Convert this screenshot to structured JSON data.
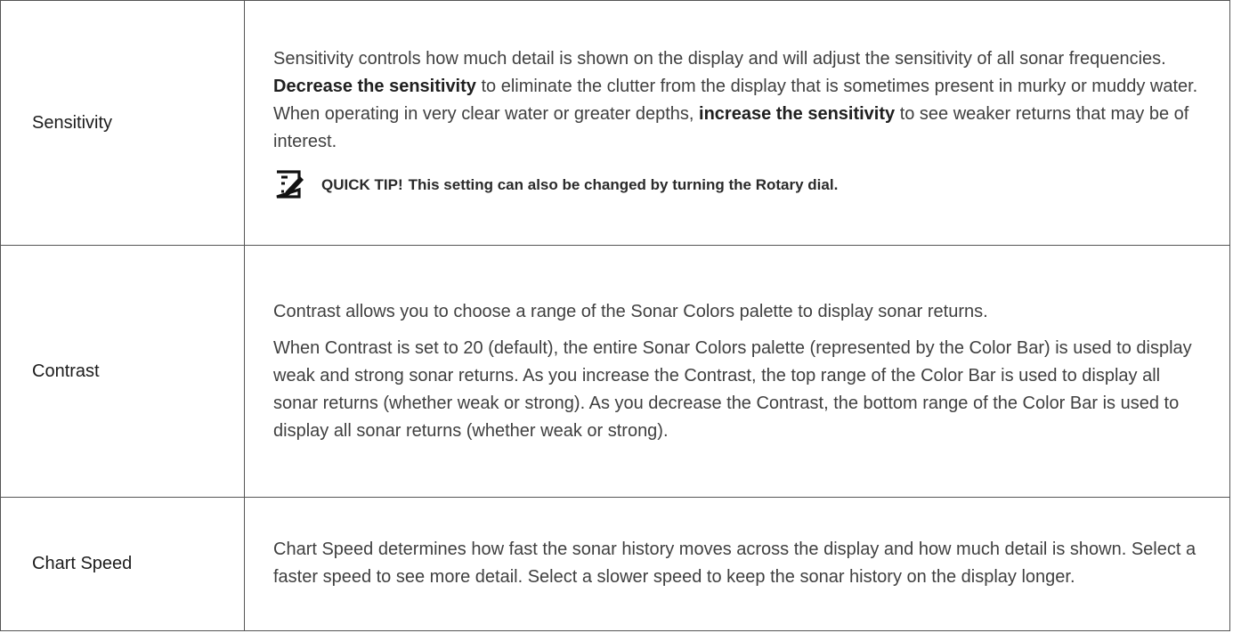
{
  "rows": [
    {
      "name": "Sensitivity",
      "desc": {
        "t1": "Sensitivity controls how much detail is shown on the display and will adjust the sensitivity of all sonar frequencies. ",
        "b1": "Decrease the sensitivity",
        "t2": " to eliminate the clutter from the display that is sometimes present in murky or muddy water. When operating in very clear water or greater depths, ",
        "b2": "increase the sensitivity",
        "t3": " to see weaker returns that may be of interest."
      },
      "tip": {
        "label": "QUICK TIP!",
        "text": "This setting can also be changed by turning the Rotary dial.",
        "icon": "note-pencil-icon"
      }
    },
    {
      "name": "Contrast",
      "p1": "Contrast allows you to choose a range of the Sonar Colors palette to display sonar returns.",
      "p2": "When Contrast is set to 20 (default), the entire Sonar Colors palette (represented by the Color Bar) is used to display weak and strong sonar returns. As you increase the Contrast, the top range of the Color Bar is used to display all sonar returns (whether weak or strong). As you decrease the Contrast, the bottom range of the Color Bar is used to display all sonar returns (whether weak or strong)."
    },
    {
      "name": "Chart Speed",
      "p1": "Chart Speed determines how fast the sonar history moves across the display and how much detail is shown. Select a faster speed to see more detail. Select a slower speed to keep the sonar history on the display longer."
    }
  ]
}
